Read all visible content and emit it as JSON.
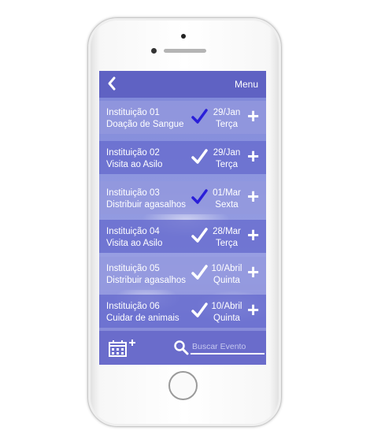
{
  "header": {
    "back_icon": "chevron-left-icon",
    "menu_label": "Menu"
  },
  "events": [
    {
      "institution": "Instituição 01",
      "activity": "Doação de Sangue",
      "date": "29/Jan",
      "weekday": "Terça",
      "checked_color": "#2a1fd9"
    },
    {
      "institution": "Instituição 02",
      "activity": "Visita ao Asilo",
      "date": "29/Jan",
      "weekday": "Terça",
      "checked_color": "#ffffff"
    },
    {
      "institution": "Instituição 03",
      "activity": "Distribuir agasalhos",
      "date": "01/Mar",
      "weekday": "Sexta",
      "checked_color": "#2a1fd9"
    },
    {
      "institution": "Instituição 04",
      "activity": "Visita ao Asilo",
      "date": "28/Mar",
      "weekday": "Terça",
      "checked_color": "#ffffff"
    },
    {
      "institution": "Instituição 05",
      "activity": "Distribuir agasalhos",
      "date": "10/Abril",
      "weekday": "Quinta",
      "checked_color": "#ffffff"
    },
    {
      "institution": "Instituição 06",
      "activity": "Cuidar de animais",
      "date": "10/Abril",
      "weekday": "Quinta",
      "checked_color": "#ffffff"
    }
  ],
  "plus_label": "+",
  "footer": {
    "add_event_icon": "calendar-plus-icon",
    "search_icon": "search-icon",
    "search_placeholder": "Buscar Evento"
  }
}
